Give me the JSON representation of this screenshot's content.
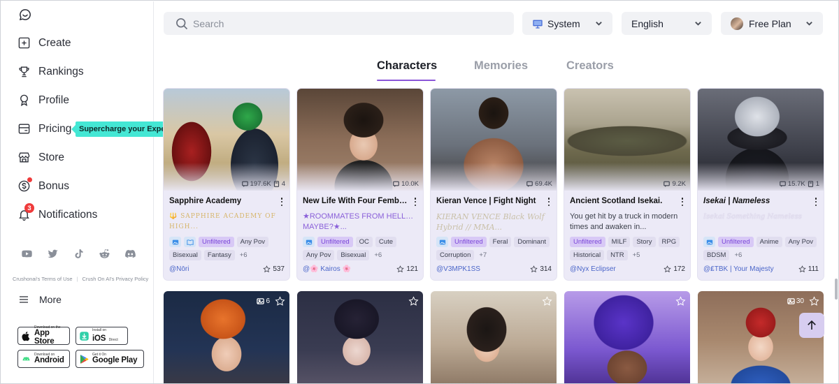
{
  "sidebar": {
    "nav": [
      {
        "label": "Create",
        "icon": "plus-square-icon"
      },
      {
        "label": "Rankings",
        "icon": "trophy-icon"
      },
      {
        "label": "Profile",
        "icon": "profile-icon"
      },
      {
        "label": "Pricing",
        "icon": "card-icon"
      },
      {
        "label": "Store",
        "icon": "store-icon"
      },
      {
        "label": "Bonus",
        "icon": "coin-icon"
      },
      {
        "label": "Notifications",
        "icon": "bell-icon"
      }
    ],
    "notifications_count": "3",
    "pricing_tooltip": "Supercharge your Experience",
    "terms": "Crushonai's Terms of Use",
    "privacy": "Crush On AI's Privacy Policy",
    "more_label": "More",
    "store_buttons": {
      "appstore": {
        "small": "Download on the",
        "big": "App Store"
      },
      "ios": {
        "small": "Install on",
        "big": "iOS",
        "sub": "Direct"
      },
      "android": {
        "small": "Download on",
        "big": "Android"
      },
      "googleplay": {
        "small": "Get it On",
        "big": "Google Play"
      }
    }
  },
  "topbar": {
    "search_placeholder": "Search",
    "theme": "System",
    "language": "English",
    "plan": "Free Plan"
  },
  "tabs": [
    {
      "label": "Characters",
      "active": true
    },
    {
      "label": "Memories",
      "active": false
    },
    {
      "label": "Creators",
      "active": false
    }
  ],
  "cards": [
    {
      "title": "Sapphire Academy",
      "messages": "197.6K",
      "memories": "4",
      "desc": "🔱 SAPPHIRE ACADEMY OF HIGH...",
      "desc_style": "gold",
      "icons": [
        "image",
        "book"
      ],
      "tags": [
        "Unfiltered",
        "Any Pov",
        "Bisexual",
        "Fantasy"
      ],
      "more_tags": "+6",
      "creator": "@Nōri",
      "likes": "537"
    },
    {
      "title": "New Life With Four Fembo...",
      "messages": "10.0K",
      "desc": "★ROOMMATES FROM HELL… MAYBE?★...",
      "desc_style": "purple",
      "icons": [
        "image"
      ],
      "tags": [
        "Unfiltered",
        "OC",
        "Cute",
        "Any Pov",
        "Bisexual"
      ],
      "more_tags": "+6",
      "creator": "@🌸 Kairos 🌸",
      "likes": "121"
    },
    {
      "title": "Kieran Vence | Fight Night",
      "messages": "69.4K",
      "desc": "KIERAN VENCE Black Wolf Hybrid // MMA...",
      "desc_style": "ghost",
      "icons": [
        "image"
      ],
      "tags": [
        "Unfiltered",
        "Feral",
        "Dominant",
        "Corruption"
      ],
      "more_tags": "+7",
      "creator": "@V3MPK1SS",
      "likes": "314"
    },
    {
      "title": "Ancient Scotland Isekai.",
      "messages": "9.2K",
      "desc": "You get hit by a truck in modern times and awaken in...",
      "desc_style": "normal",
      "icons": [],
      "tags": [
        "Unfiltered",
        "MILF",
        "Story",
        "RPG",
        "Historical",
        "NTR"
      ],
      "more_tags": "+5",
      "creator": "@Nyx Eclipser",
      "likes": "172"
    },
    {
      "title": "Isekai | Nameless",
      "messages": "15.7K",
      "memories": "1",
      "desc": "Isekai Something Nameless",
      "desc_style": "ghostlight",
      "icons": [
        "image"
      ],
      "tags": [
        "Unfiltered",
        "Anime",
        "Any Pov",
        "BDSM"
      ],
      "more_tags": "+6",
      "creator": "@₤TBK | Your Majesty",
      "likes": "111"
    }
  ],
  "row2": [
    {
      "imgcount": "6"
    },
    {
      "imgcount": ""
    },
    {
      "imgcount": ""
    },
    {
      "imgcount": ""
    },
    {
      "imgcount": "30"
    }
  ],
  "colors": {
    "accent": "#8a55d8",
    "tooltip": "#44e7d4",
    "badge": "#ef3b3b",
    "card_bg": "#eceaf7"
  }
}
